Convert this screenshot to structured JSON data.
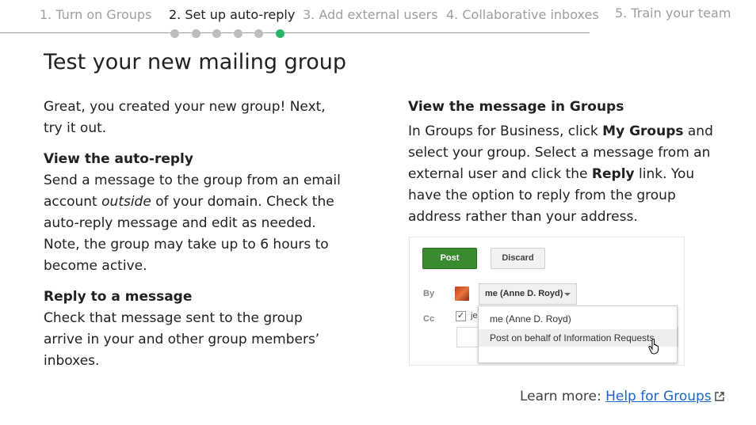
{
  "tabs": [
    {
      "label": "1. Turn on Groups",
      "active": false
    },
    {
      "label": "2. Set up auto-reply",
      "active": true
    },
    {
      "label": "3. Add external users",
      "active": false
    },
    {
      "label": "4. Collaborative inboxes",
      "active": false
    },
    {
      "label": "5. Train your team",
      "active": false
    }
  ],
  "progress": {
    "total_dots": 6,
    "current_dot": 6,
    "active_color": "#2bb56b",
    "inactive_color": "#bdbdbd"
  },
  "page_title": "Test your new mailing group",
  "left": {
    "intro": "Great, you created your new group! Next, try it out.",
    "section1_heading": "View the auto-reply",
    "section1_text_a": "Send a message to the group from an email account ",
    "section1_text_em": "outside",
    "section1_text_b": " of your domain. Check the auto-reply message and edit as needed. Note, the group may take up to 6 hours to become active.",
    "section2_heading": "Reply to a message",
    "section2_text": "Check that message sent to the group arrive in your and other group members’ inboxes."
  },
  "right": {
    "heading": "View the message in Groups",
    "text_a": "In Groups for Business, click ",
    "text_bold1": "My Groups",
    "text_b": " and select your group. Select a message from an external user and click the ",
    "text_bold2": "Reply",
    "text_c": " link. You have the option to reply from the group address rather than your address."
  },
  "screenshot": {
    "post_label": "Post",
    "discard_label": "Discard",
    "by_label": "By",
    "cc_label": "Cc",
    "from_value": "me (Anne D. Royd)",
    "cc_partial": "je",
    "options": [
      "me (Anne D. Royd)",
      "Post on behalf of Information Requests"
    ],
    "post_color": "#3a8a2f"
  },
  "footer": {
    "learn_prefix": "Learn more: ",
    "learn_link": "Help for Groups",
    "link_color": "#1a66c7"
  }
}
